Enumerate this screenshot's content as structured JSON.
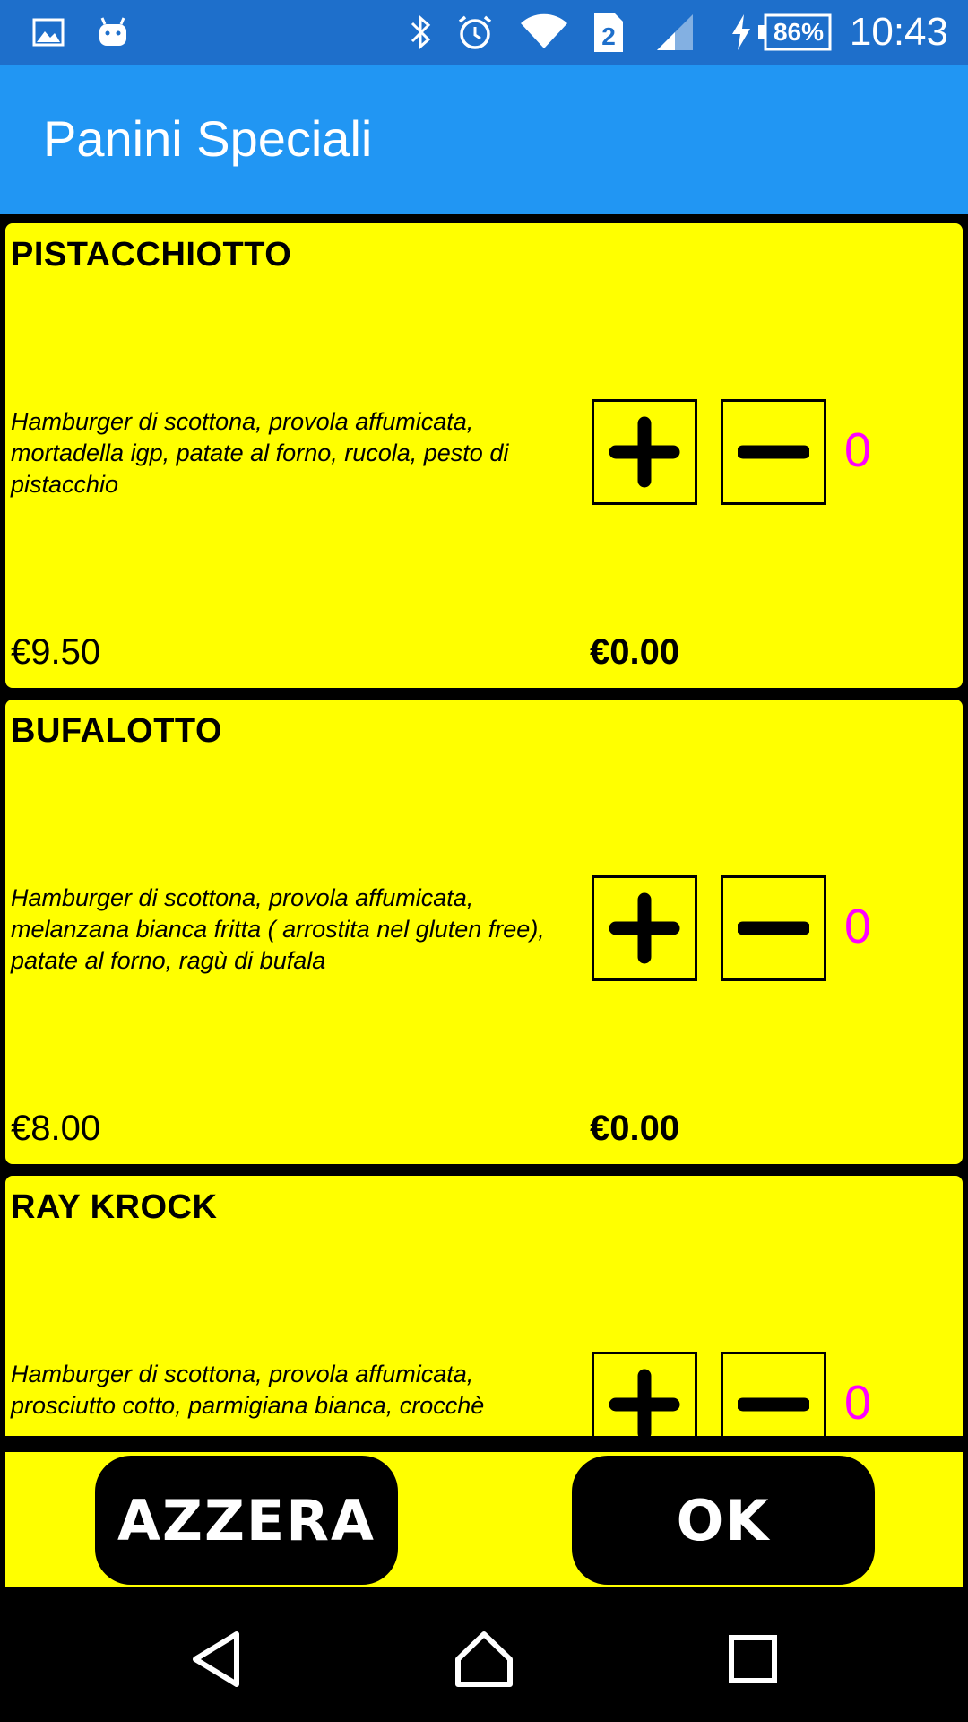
{
  "status_bar": {
    "time": "10:43",
    "battery_percent": "86%",
    "sim_slot": "2",
    "icons": [
      "image-icon",
      "android-icon",
      "bluetooth-icon",
      "alarm-icon",
      "wifi-icon",
      "sim-icon",
      "signal-icon",
      "charging-icon",
      "battery-icon"
    ]
  },
  "app_bar": {
    "title": "Panini Speciali",
    "color": "#2196F3"
  },
  "colors": {
    "card": "#FFFF00",
    "count": "#FF00FF",
    "button": "#000000"
  },
  "items": [
    {
      "name": "PISTACCHIOTTO",
      "description": "Hamburger di scottona, provola affumicata, mortadella igp, patate al forno, rucola, pesto di pistacchio",
      "price": "€9.50",
      "total": "€0.00",
      "count": "0"
    },
    {
      "name": "BUFALOTTO",
      "description": "Hamburger di scottona, provola affumicata, melanzana bianca  fritta ( arrostita nel gluten free), patate al forno, ragù di bufala",
      "price": "€8.00",
      "total": "€0.00",
      "count": "0"
    },
    {
      "name": "RAY KROCK",
      "description": "Hamburger di scottona, provola affumicata, prosciutto cotto, parmigiana bianca, crocchè",
      "price": "",
      "total": "",
      "count": "0"
    }
  ],
  "actions": {
    "reset_label": "AZZERA",
    "ok_label": "OK"
  },
  "nav": {
    "icons": [
      "back-icon",
      "home-icon",
      "recents-icon"
    ]
  }
}
